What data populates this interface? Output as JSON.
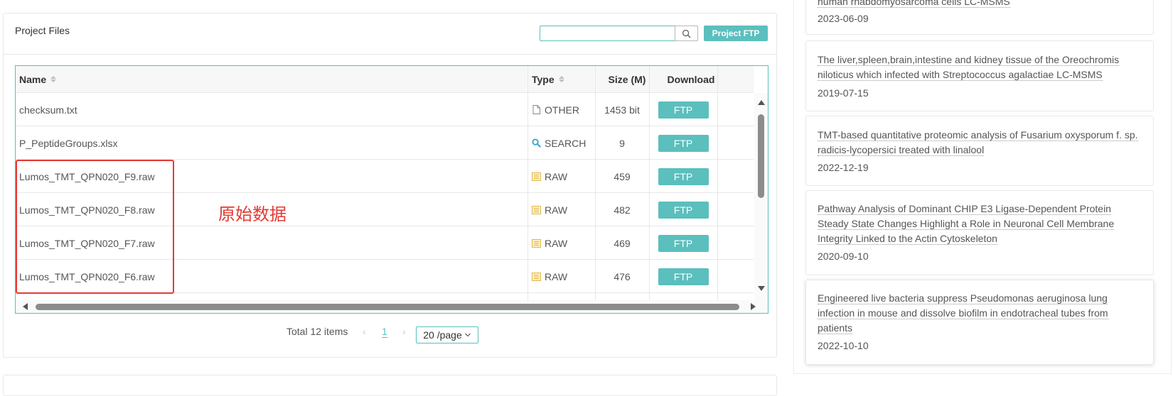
{
  "project_files": {
    "title": "Project Files",
    "search_value": "",
    "ftp_button": "Project FTP",
    "columns": {
      "name": "Name",
      "type": "Type",
      "size": "Size (M)",
      "download": "Download"
    },
    "rows": [
      {
        "name": "checksum.txt",
        "type": "OTHER",
        "type_icon": "file-icon",
        "size": "1453 bit",
        "download": "FTP"
      },
      {
        "name": "P_PeptideGroups.xlsx",
        "type": "SEARCH",
        "type_icon": "search-icon",
        "size": "9",
        "download": "FTP"
      },
      {
        "name": "Lumos_TMT_QPN020_F9.raw",
        "type": "RAW",
        "type_icon": "list-icon",
        "size": "459",
        "download": "FTP"
      },
      {
        "name": "Lumos_TMT_QPN020_F8.raw",
        "type": "RAW",
        "type_icon": "list-icon",
        "size": "482",
        "download": "FTP"
      },
      {
        "name": "Lumos_TMT_QPN020_F7.raw",
        "type": "RAW",
        "type_icon": "list-icon",
        "size": "469",
        "download": "FTP"
      },
      {
        "name": "Lumos_TMT_QPN020_F6.raw",
        "type": "RAW",
        "type_icon": "list-icon",
        "size": "476",
        "download": "FTP"
      }
    ],
    "pagination": {
      "total": "Total 12 items",
      "current_page": "1",
      "page_size": "20 /page"
    },
    "annotation": "原始数据",
    "colors": {
      "accent": "#5bbfbd",
      "annotation": "#e53935",
      "raw_icon": "#e2b84a"
    }
  },
  "sidebar": {
    "cards": [
      {
        "title": "human rhabdomyosarcoma cells LC-MSMS",
        "date": "2023-06-09"
      },
      {
        "title_lines": [
          "The liver,spleen,brain,intestine and kidney tissue of the Oreochromis",
          "niloticus which infected with Streptococcus agalactiae LC-MSMS"
        ],
        "date": "2019-07-15"
      },
      {
        "title_lines": [
          "TMT-based quantitative proteomic analysis of Fusarium oxysporum f. sp.",
          "radicis-lycopersici treated with linalool"
        ],
        "date": "2022-12-19"
      },
      {
        "title_lines": [
          "Pathway Analysis of Dominant CHIP E3 Ligase-Dependent Protein",
          "Steady State Changes Highlight a Role in Neuronal Cell Membrane",
          "Integrity Linked to the Actin Cytoskeleton"
        ],
        "date": "2020-09-10"
      },
      {
        "title_lines": [
          "Engineered live bacteria suppress Pseudomonas aeruginosa lung",
          "infection in mouse and dissolve biofilm in endotracheal tubes from",
          "patients"
        ],
        "date": "2022-10-10"
      }
    ]
  }
}
